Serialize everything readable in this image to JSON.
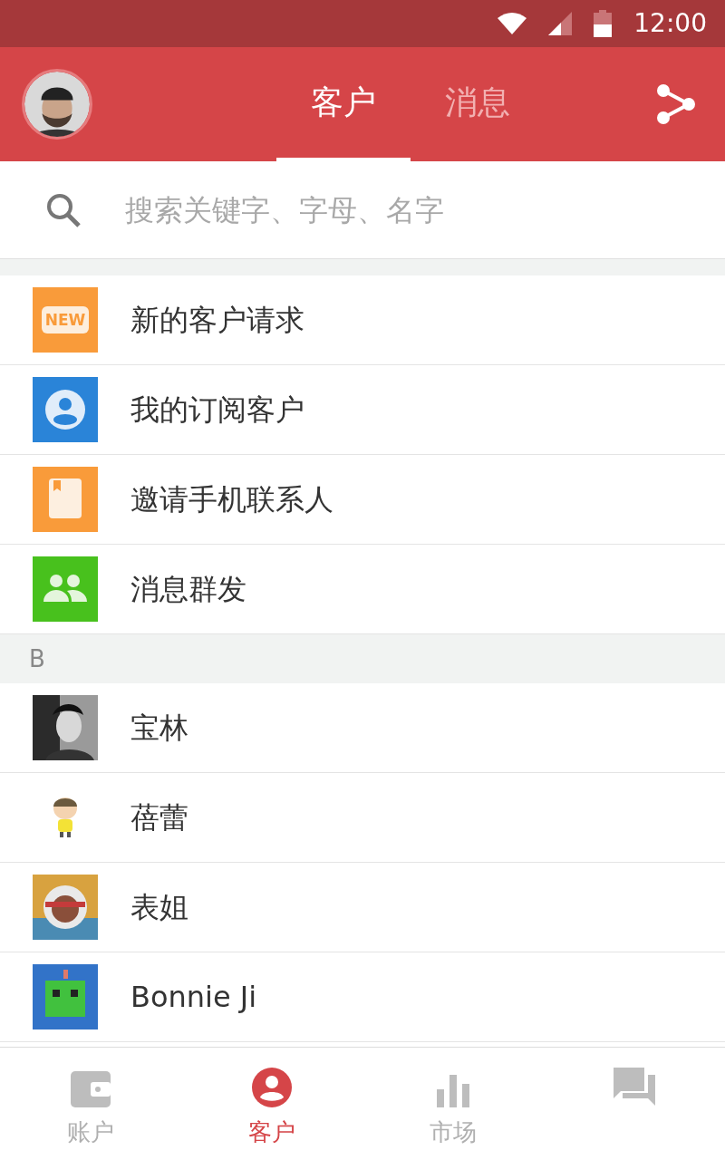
{
  "status_bar": {
    "time": "12:00"
  },
  "header": {
    "tabs": [
      {
        "label": "客户",
        "selected": true
      },
      {
        "label": "消息",
        "selected": false
      }
    ]
  },
  "search": {
    "placeholder": "搜索关键字、字母、名字"
  },
  "shortcuts": [
    {
      "kind": "new",
      "badge": "NEW",
      "label": "新的客户请求",
      "color": "#f99b3a"
    },
    {
      "kind": "person",
      "label": "我的订阅客户",
      "color": "#2a84d8"
    },
    {
      "kind": "book",
      "label": "邀请手机联系人",
      "color": "#f99b3a"
    },
    {
      "kind": "group",
      "label": "消息群发",
      "color": "#48c11d"
    }
  ],
  "sections": [
    {
      "letter": "B",
      "contacts": [
        {
          "name": "宝林",
          "kind": "portrait"
        },
        {
          "name": "蓓蕾",
          "kind": "cartoon"
        },
        {
          "name": "表姐",
          "kind": "helmet"
        },
        {
          "name": "Bonnie Ji",
          "kind": "robot"
        }
      ]
    }
  ],
  "bottom_nav": [
    {
      "kind": "wallet",
      "label": "账户",
      "selected": false
    },
    {
      "kind": "person",
      "label": "客户",
      "selected": true
    },
    {
      "kind": "chart",
      "label": "市场",
      "selected": false
    },
    {
      "kind": "chat",
      "selected": false
    }
  ]
}
